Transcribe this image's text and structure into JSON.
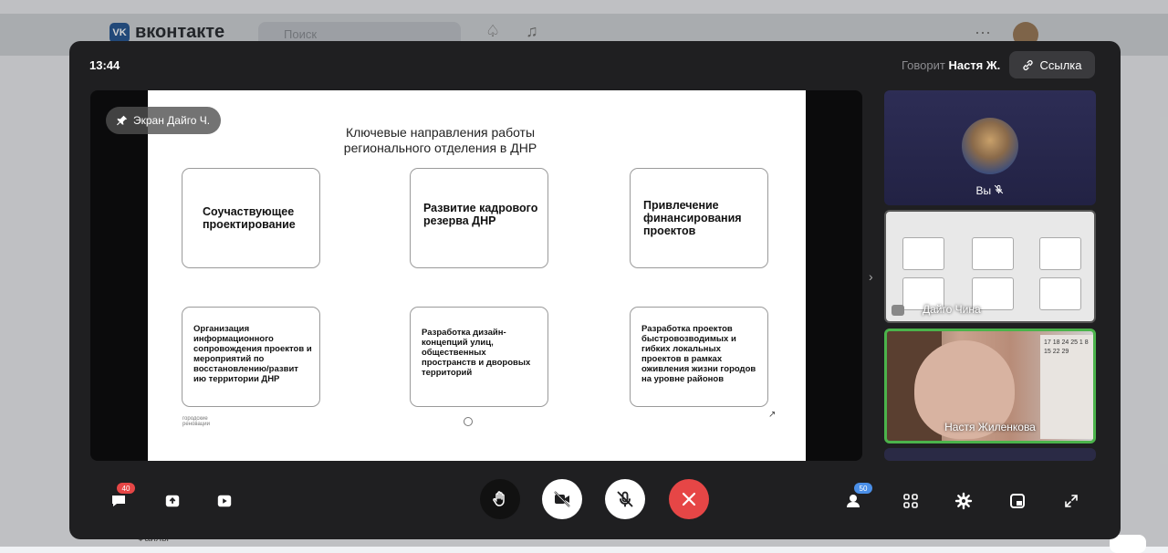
{
  "background": {
    "logo_text": "вконтакте",
    "logo_mark": "VK",
    "search_placeholder": "Поиск",
    "files_label": "Файлы"
  },
  "call": {
    "time": "13:44",
    "speaking_prefix": "Говорит",
    "speaking_name": "Настя Ж.",
    "link_label": "Ссылка",
    "pin_label": "Экран Дайго Ч.",
    "slide": {
      "title_line1": "Ключевые направления работы",
      "title_line2": "регионального отделения в ДНР",
      "cards": [
        "Соучаствующее проектирование",
        "Развитие кадрового резерва ДНР",
        "Привлечение финансирования проектов",
        "Организация информационного сопровождения проектов и мероприятий по восстановлению/развит ию территории ДНР",
        "Разработка дизайн-концепций улиц, общественных пространств и дворовых территорий",
        "Разработка проектов быстровозводимых и гибких локальных проектов в рамках оживления жизни городов на уровне районов"
      ],
      "logo_line1": "городские",
      "logo_line2": "реновации"
    },
    "participants": [
      {
        "label": "Вы"
      },
      {
        "label": "Дайго Чина"
      },
      {
        "label": "Настя Жиленкова"
      }
    ],
    "calendar_text": "17 18 24 25 1 8 15 22 29",
    "controls": {
      "chat_badge": "40",
      "participants_badge": "50"
    }
  }
}
